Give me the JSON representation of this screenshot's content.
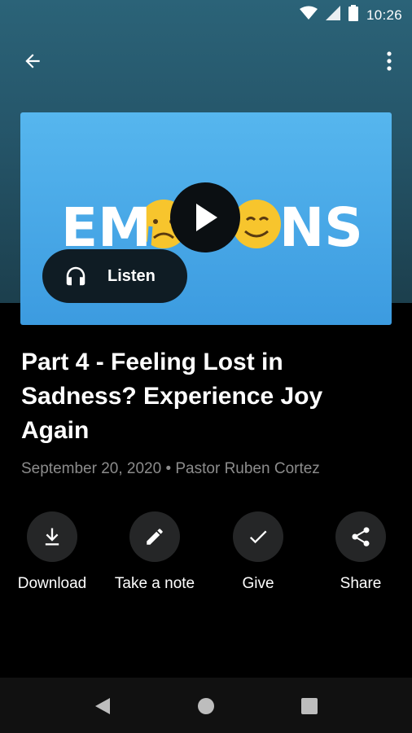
{
  "status_bar": {
    "time": "10:26",
    "icons": [
      "wifi-icon",
      "cell-signal-icon",
      "battery-icon"
    ]
  },
  "app_bar": {
    "back_icon": "arrow-back-icon",
    "menu_icon": "more-vert-icon"
  },
  "hero": {
    "artwork_text": "EMOTIONS",
    "play_icon": "play-icon",
    "listen_label": "Listen",
    "listen_icon": "headphones-icon"
  },
  "sermon": {
    "title": "Part 4 - Feeling Lost in Sadness? Experience Joy Again",
    "meta": "September 20, 2020 • Pastor Ruben Cortez"
  },
  "actions": [
    {
      "label": "Download",
      "icon": "download-icon"
    },
    {
      "label": "Take a note",
      "icon": "pencil-icon"
    },
    {
      "label": "Give",
      "icon": "check-icon"
    },
    {
      "label": "Share",
      "icon": "share-icon"
    }
  ],
  "nav_bar": {
    "icons": [
      "nav-back-icon",
      "nav-home-icon",
      "nav-recents-icon"
    ]
  },
  "colors": {
    "header_top": "#2b6378",
    "hero_blue": "#4aa9e8",
    "action_circle": "#252627",
    "meta_text": "#8c8c8c"
  }
}
